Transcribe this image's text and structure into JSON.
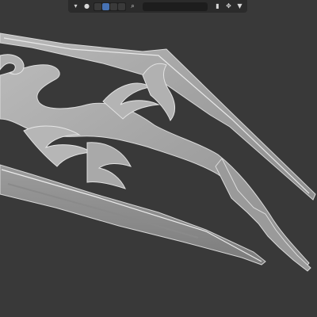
{
  "viewport": {
    "background": "#393939",
    "model_color": "#a7a7a7",
    "model_edge": "#e4e4e4"
  },
  "header": {
    "icons": [
      "visibility-icon",
      "overlay-icon",
      "shading-solid-icon",
      "shading-material-icon",
      "shading-rendered-icon",
      "search-icon",
      "bookmark-icon",
      "move-icon",
      "filter-icon"
    ],
    "search": {
      "value": "",
      "placeholder": ""
    },
    "active_shading": "solid"
  }
}
